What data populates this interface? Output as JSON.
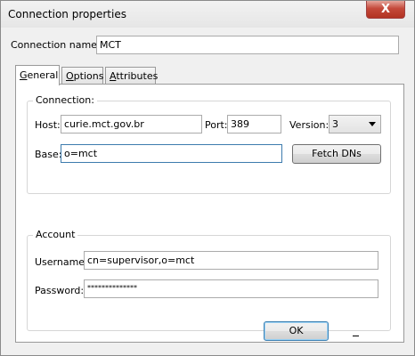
{
  "window": {
    "title": "Connection properties",
    "close_glyph": "X"
  },
  "connection_name": {
    "label": "Connection name:",
    "value": "MCT"
  },
  "tabs": [
    {
      "label_u": "G",
      "label_rest": "eneral"
    },
    {
      "label_u": "O",
      "label_rest": "ptions"
    },
    {
      "label_u": "A",
      "label_rest": "ttributes"
    }
  ],
  "connection": {
    "title": "Connection:",
    "host_label": "Host:",
    "host_value": "curie.mct.gov.br",
    "port_label": "Port:",
    "port_value": "389",
    "version_label": "Version:",
    "version_value": "3",
    "base_label": "Base:",
    "base_value": "o=mct",
    "fetch_dns_label": "Fetch DNs"
  },
  "account": {
    "title": "Account",
    "username_label": "Username:",
    "username_value": "cn=supervisor,o=mct",
    "password_label": "Password:",
    "password_value": "**************"
  },
  "buttons": {
    "ok_label": "OK"
  },
  "icons": {
    "close": "close-icon",
    "dropdown": "chevron-down-icon"
  }
}
